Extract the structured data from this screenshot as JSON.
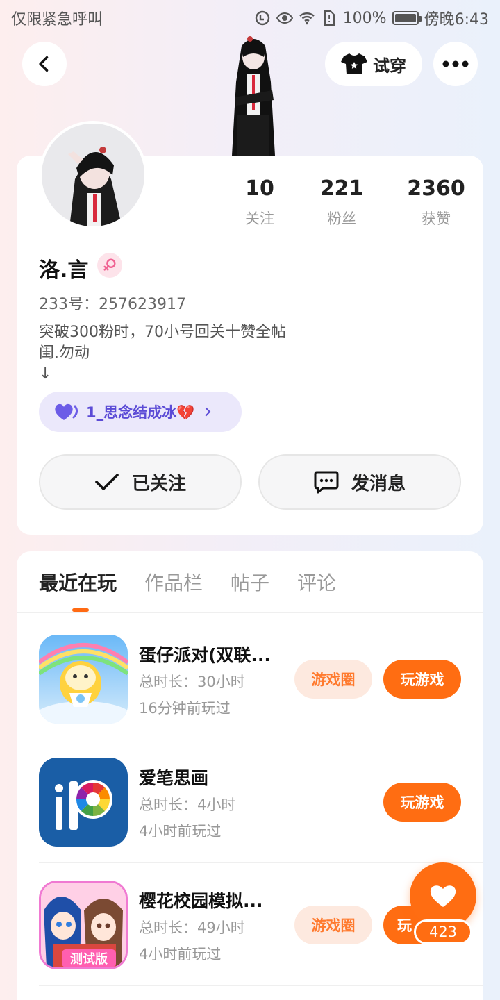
{
  "status_bar": {
    "carrier": "仅限紧急呼叫",
    "battery": "100%",
    "time": "傍晚6:43"
  },
  "header": {
    "tryon_label": "试穿",
    "back_icon": "chevron-left-icon",
    "more_icon": "more-dots-icon"
  },
  "profile": {
    "stats": [
      {
        "value": "10",
        "label": "关注"
      },
      {
        "value": "221",
        "label": "粉丝"
      },
      {
        "value": "2360",
        "label": "获赞"
      }
    ],
    "name": "洛.言",
    "gender_icon": "female-icon",
    "uid": "233号：257623917",
    "bio": "突破300粉时，70小号回关十赞全帖\n闺.勿动\n↓",
    "tag": {
      "label": "1_思念结成冰💔",
      "icon": "purple-heart-icon"
    },
    "follow_button": "已关注",
    "message_button": "发消息"
  },
  "tabs": [
    {
      "label": "最近在玩",
      "active": true
    },
    {
      "label": "作品栏",
      "active": false
    },
    {
      "label": "帖子",
      "active": false
    },
    {
      "label": "评论",
      "active": false
    }
  ],
  "games": [
    {
      "name": "蛋仔派对(双联...",
      "duration": "总时长：30小时",
      "last_played": "16分钟前玩过",
      "circle_label": "游戏圈",
      "play_label": "玩游戏",
      "has_circle": true
    },
    {
      "name": "爱笔思画",
      "duration": "总时长：4小时",
      "last_played": "4小时前玩过",
      "circle_label": "",
      "play_label": "玩游戏",
      "has_circle": false
    },
    {
      "name": "樱花校园模拟...",
      "duration": "总时长：49小时",
      "last_played": "4小时前玩过",
      "circle_label": "游戏圈",
      "play_label": "玩",
      "has_circle": true,
      "icon_text": "测试版"
    }
  ],
  "like": {
    "count": "423",
    "icon": "heart-icon"
  },
  "colors": {
    "accent": "#ff6d12",
    "accent_soft": "#fde9df",
    "tag_bg": "#ebe8fb",
    "tag_text": "#5b4bd6"
  }
}
